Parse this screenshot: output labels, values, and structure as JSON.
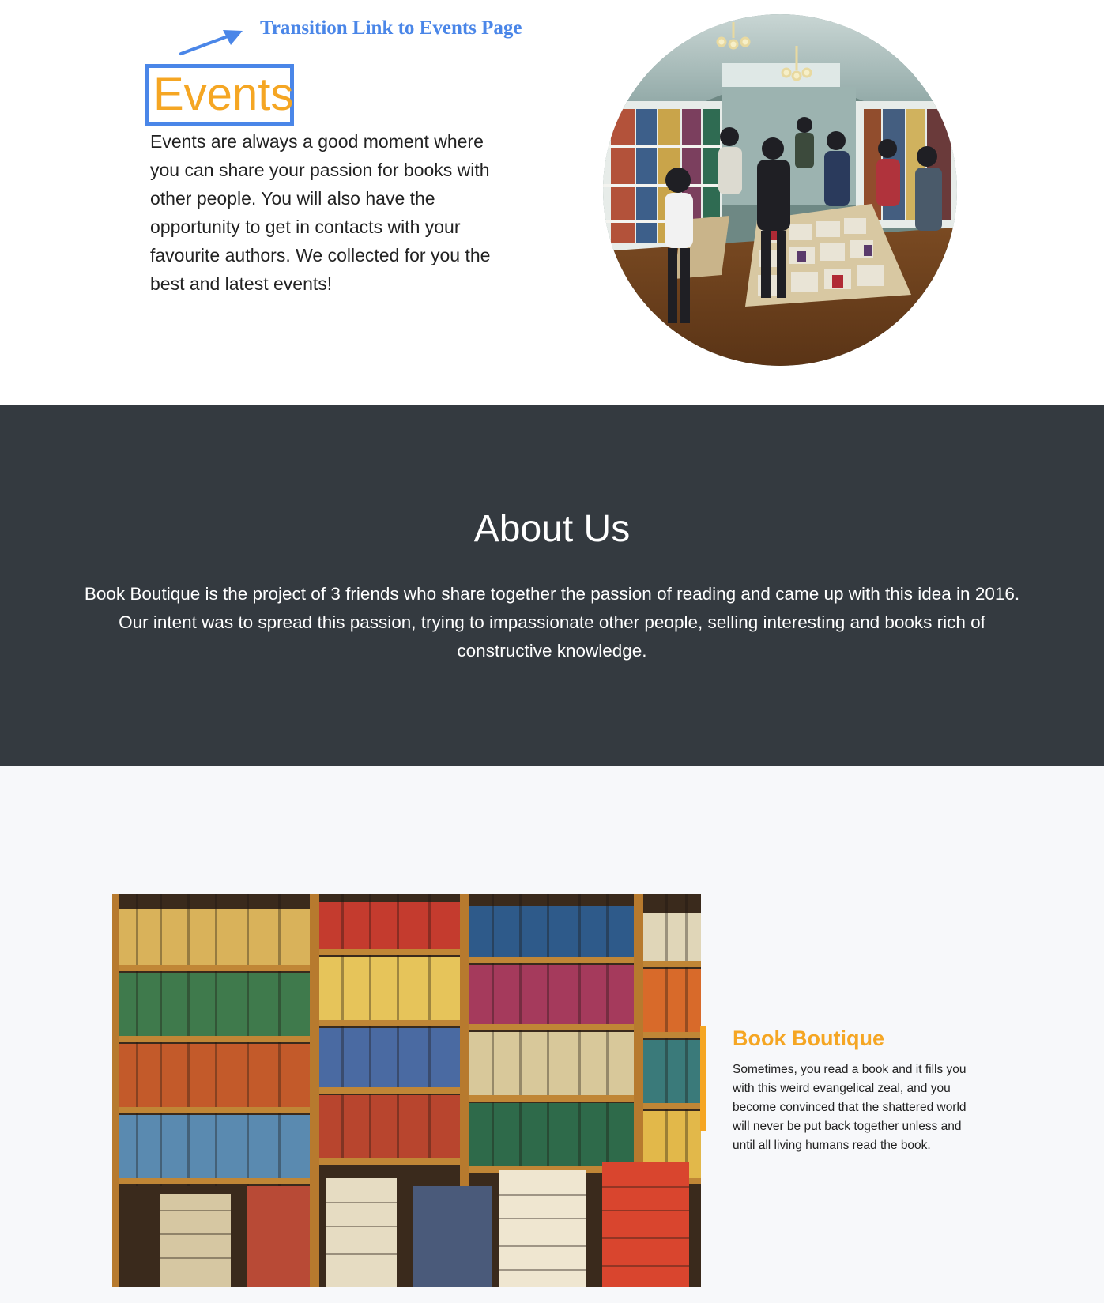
{
  "annotation": {
    "label": "Transition Link to Events Page",
    "color": "#4a86e8"
  },
  "events": {
    "title": "Events",
    "text": "Events are always a good moment where you can share your passion for books with other people. You will also have the opportunity to get in contacts with your favourite authors. We collected for you the best and latest events!",
    "image_icon": "bookstore-crowd-photo",
    "accent_color": "#f5a623"
  },
  "about": {
    "title": "About Us",
    "text": "Book Boutique is the project of 3 friends who share together the passion of reading and came up with this idea in 2016. Our intent was to spread this passion, trying to impassionate other people, selling interesting and books rich of constructive knowledge.",
    "background": "#343a40"
  },
  "boutique": {
    "title": "Book Boutique",
    "text": "Sometimes, you read a book and it fills you with this weird evangelical zeal, and you become convinced that the shattered world will never be put back together unless and until all living humans read the book.",
    "image_icon": "bookshelves-photo",
    "accent_color": "#f5a623"
  }
}
